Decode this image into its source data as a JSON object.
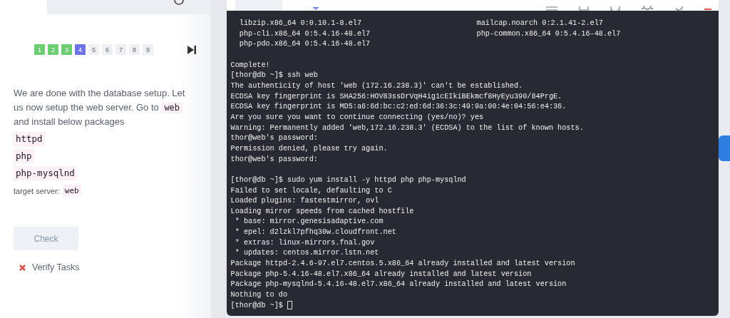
{
  "task_panel": {
    "steps": [
      {
        "label": "1",
        "done": true,
        "selected": false
      },
      {
        "label": "2",
        "done": true,
        "selected": false
      },
      {
        "label": "3",
        "done": true,
        "selected": false
      },
      {
        "label": "4",
        "done": false,
        "selected": true
      },
      {
        "label": "5",
        "done": false,
        "selected": false
      },
      {
        "label": "6",
        "done": false,
        "selected": false
      },
      {
        "label": "7",
        "done": false,
        "selected": false
      },
      {
        "label": "8",
        "done": false,
        "selected": false
      },
      {
        "label": "9",
        "done": false,
        "selected": false
      }
    ],
    "description": [
      {
        "kind": "text",
        "text": "We are done with the database setup. Let us now setup the web server. Go to "
      },
      {
        "kind": "code",
        "text": "web"
      },
      {
        "kind": "text",
        "text": " and install below packages"
      }
    ],
    "packages": [
      "httpd",
      "php",
      "php-mysqlnd"
    ],
    "target_label": "target server:",
    "target_server": "web",
    "check_button": "Check",
    "verify": {
      "label": "Verify Tasks",
      "passed": false
    }
  },
  "terminal": {
    "lines": [
      {
        "kind": "columns",
        "cells": [
          "  libzip.x86_64 0:0.10.1-8.el7",
          "mailcap.noarch 0:2.1.41-2.el7"
        ]
      },
      {
        "kind": "columns",
        "cells": [
          "  php-cli.x86_64 0:5.4.16-48.el7",
          "php-common.x86_64 0:5.4.16-48.el7"
        ]
      },
      {
        "kind": "text",
        "text": "  php-pdo.x86_64 0:5.4.16-48.el7"
      },
      {
        "kind": "blank"
      },
      {
        "kind": "text",
        "text": "Complete!"
      },
      {
        "kind": "text",
        "text": "[thor@db ~]$ ssh web"
      },
      {
        "kind": "text",
        "text": "The authenticity of host 'web (172.16.238.3)' can't be established."
      },
      {
        "kind": "text",
        "text": "ECDSA key fingerprint is SHA256:HOV83ssDrVqH4ig1cEIkiBEkmcf8HyEyu390/84PrgE."
      },
      {
        "kind": "text",
        "text": "ECDSA key fingerprint is MD5:a6:6d:bc:c2:ed:6d:36:3c:49:9a:00:4e:04:56:e4:36."
      },
      {
        "kind": "text",
        "text": "Are you sure you want to continue connecting (yes/no)? yes"
      },
      {
        "kind": "text",
        "text": "Warning: Permanently added 'web,172.16.238.3' (ECDSA) to the list of known hosts."
      },
      {
        "kind": "text",
        "text": "thor@web's password:"
      },
      {
        "kind": "text",
        "text": "Permission denied, please try again."
      },
      {
        "kind": "text",
        "text": "thor@web's password:"
      },
      {
        "kind": "blank"
      },
      {
        "kind": "text",
        "text": "[thor@db ~]$ sudo yum install -y httpd php php-mysqlnd"
      },
      {
        "kind": "text",
        "text": "Failed to set locale, defaulting to C"
      },
      {
        "kind": "text",
        "text": "Loaded plugins: fastestmirror, ovl"
      },
      {
        "kind": "text",
        "text": "Loading mirror speeds from cached hostfile"
      },
      {
        "kind": "text",
        "text": " * base: mirror.genesisadaptive.com"
      },
      {
        "kind": "text",
        "text": " * epel: d2lzkl7pfhq30w.cloudfront.net"
      },
      {
        "kind": "text",
        "text": " * extras: linux-mirrors.fnal.gov"
      },
      {
        "kind": "text",
        "text": " * updates: centos.mirror.lstn.net"
      },
      {
        "kind": "text",
        "text": "Package httpd-2.4.6-97.el7.centos.5.x86_64 already installed and latest version"
      },
      {
        "kind": "text",
        "text": "Package php-5.4.16-48.el7.x86_64 already installed and latest version"
      },
      {
        "kind": "text",
        "text": "Package php-mysqlnd-5.4.16-48.el7.x86_64 already installed and latest version"
      },
      {
        "kind": "text",
        "text": "Nothing to do"
      },
      {
        "kind": "prompt",
        "text": "[thor@db ~]$ "
      }
    ]
  }
}
